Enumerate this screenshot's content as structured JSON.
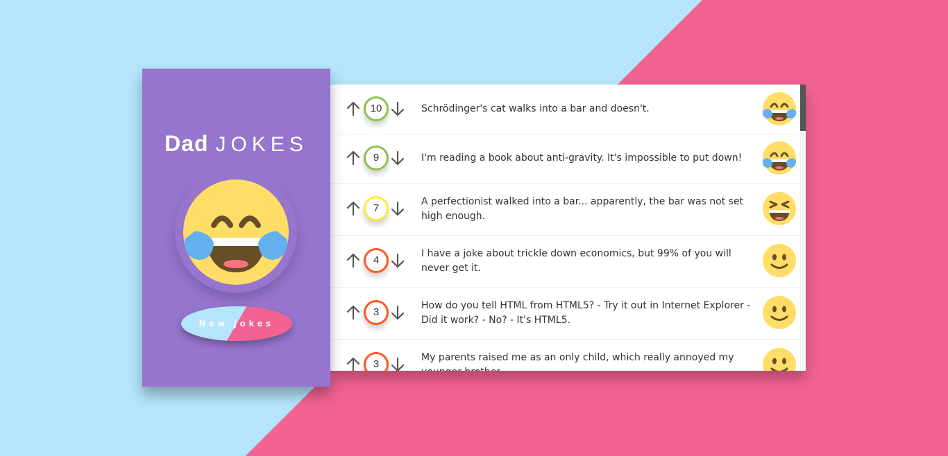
{
  "app": {
    "title_bold": "Dad",
    "title_light": "JOKES",
    "new_jokes_button": "New jokes"
  },
  "colors": {
    "sidebar": "#9575cd",
    "bg_blue": "#b4e5fa",
    "bg_pink": "#f26292",
    "score_green": "#8bc34a",
    "score_yellow": "#ffeb3b",
    "score_orange": "#ff5722"
  },
  "jokes": [
    {
      "score": "10",
      "text": "Schrödinger's cat walks into a bar and doesn't.",
      "score_color": "#8bc34a",
      "emoji": "laugh-tears-icon"
    },
    {
      "score": "9",
      "text": "I'm reading a book about anti-gravity. It's impossible to put down!",
      "score_color": "#8bc34a",
      "emoji": "laugh-tears-icon"
    },
    {
      "score": "7",
      "text": "A perfectionist walked into a bar... apparently, the bar was not set high enough.",
      "score_color": "#ffeb3b",
      "emoji": "laughing-icon"
    },
    {
      "score": "4",
      "text": "I have a joke about trickle down economics, but 99% of you will never get it.",
      "score_color": "#ff5722",
      "emoji": "smile-icon"
    },
    {
      "score": "3",
      "text": "How do you tell HTML from HTML5? - Try it out in Internet Explorer - Did it work? - No? - It's HTML5.",
      "score_color": "#ff5722",
      "emoji": "smile-icon"
    },
    {
      "score": "3",
      "text": "My parents raised me as an only child, which really annoyed my younger brother.",
      "score_color": "#ff5722",
      "emoji": "smile-icon"
    }
  ]
}
